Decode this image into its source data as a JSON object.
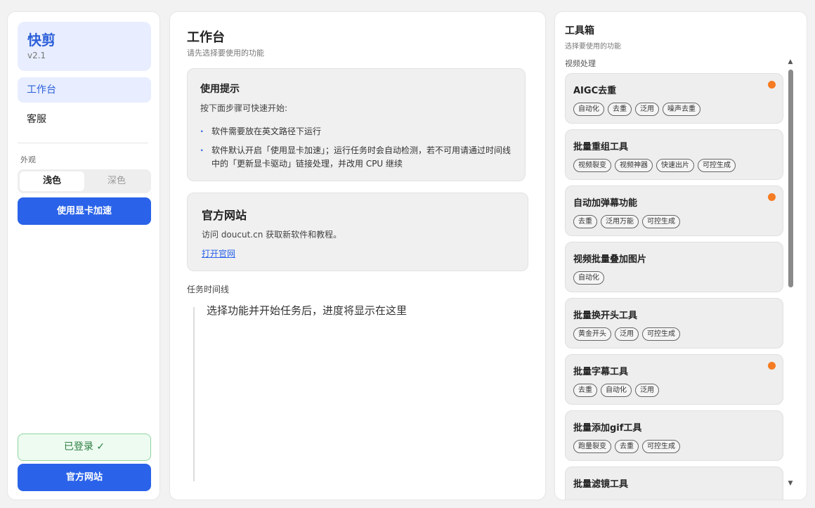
{
  "sidebar": {
    "brand_name": "快剪",
    "version": "v2.1",
    "nav": [
      {
        "label": "工作台"
      },
      {
        "label": "客服"
      }
    ],
    "appearance_label": "外观",
    "theme_light": "浅色",
    "theme_dark": "深色",
    "gpu_button": "使用显卡加速",
    "login_status": "已登录 ✓",
    "site_button": "官方网站"
  },
  "main": {
    "title": "工作台",
    "subtitle": "请先选择要使用的功能",
    "tips": {
      "title": "使用提示",
      "sub": "按下面步骤可快速开始:",
      "bullet": "·",
      "items": [
        "软件需要放在英文路径下运行",
        "软件默认开启「使用显卡加速」；运行任务时会自动检测，若不可用请通过时间线中的「更新显卡驱动」链接处理，并改用 CPU 继续"
      ]
    },
    "site": {
      "title": "官方网站",
      "desc": "访问 doucut.cn 获取新软件和教程。",
      "link": "打开官网"
    },
    "timeline_label": "任务时间线",
    "timeline_empty": "选择功能并开始任务后，进度将显示在这里"
  },
  "toolbox": {
    "title": "工具箱",
    "subtitle": "选择要使用的功能",
    "category": "视频处理",
    "scroll_up": "▲",
    "scroll_down": "▼",
    "tools": [
      {
        "name": "AIGC去重",
        "tags": [
          "自动化",
          "去重",
          "泛用",
          "噪声去重"
        ],
        "dot": true
      },
      {
        "name": "批量重组工具",
        "tags": [
          "视频裂变",
          "视频神器",
          "快速出片",
          "可控生成"
        ],
        "dot": false
      },
      {
        "name": "自动加弹幕功能",
        "tags": [
          "去重",
          "泛用万能",
          "可控生成"
        ],
        "dot": true
      },
      {
        "name": "视频批量叠加图片",
        "tags": [
          "自动化"
        ],
        "dot": false
      },
      {
        "name": "批量换开头工具",
        "tags": [
          "黄金开头",
          "泛用",
          "可控生成"
        ],
        "dot": false
      },
      {
        "name": "批量字幕工具",
        "tags": [
          "去重",
          "自动化",
          "泛用"
        ],
        "dot": true
      },
      {
        "name": "批量添加gif工具",
        "tags": [
          "跑量裂变",
          "去重",
          "可控生成"
        ],
        "dot": false
      },
      {
        "name": "批量滤镜工具",
        "tags": [],
        "dot": false
      }
    ]
  },
  "colors": {
    "accent": "#2a63e9",
    "brand_bg": "#e8eeff",
    "new_dot": "#f57c22",
    "login_green": "#2a7d3f"
  }
}
